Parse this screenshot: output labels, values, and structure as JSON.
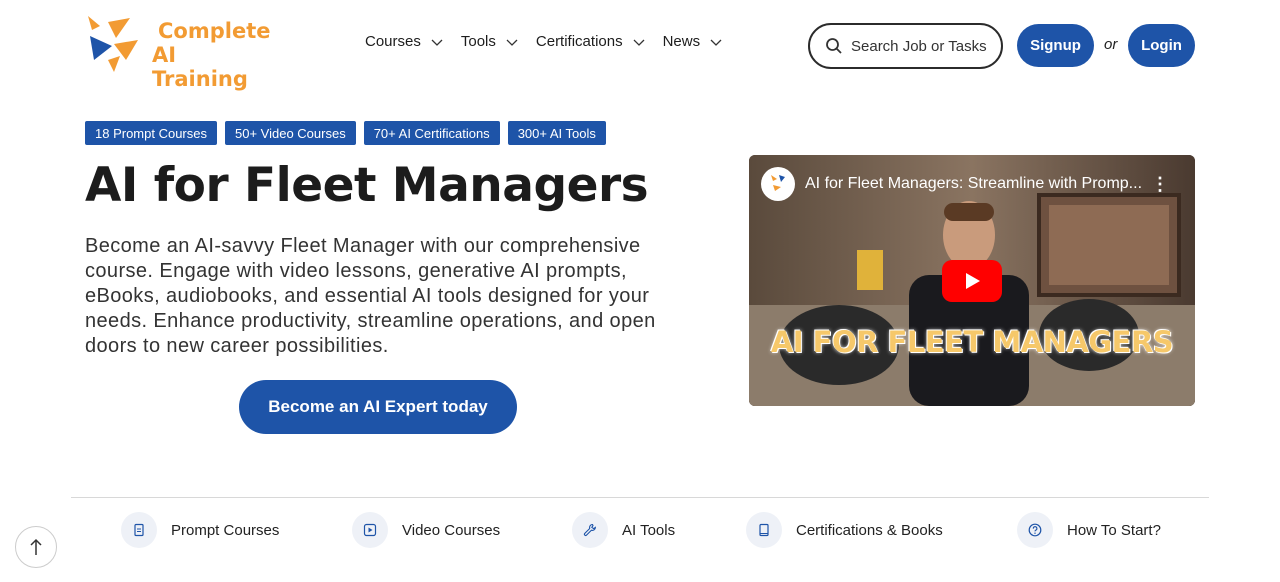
{
  "brand": {
    "line1": "Complete",
    "line2": "AI Training",
    "color": "#f29b33"
  },
  "nav": [
    {
      "label": "Courses"
    },
    {
      "label": "Tools"
    },
    {
      "label": "Certifications"
    },
    {
      "label": "News"
    }
  ],
  "search": {
    "placeholder": "Search Job or Tasks"
  },
  "auth": {
    "signup": "Signup",
    "or": "or",
    "login": "Login"
  },
  "badges": [
    "18 Prompt Courses",
    "50+ Video Courses",
    "70+ AI Certifications",
    "300+ AI Tools"
  ],
  "hero": {
    "title": "AI for Fleet Managers",
    "description": "Become an AI-savvy Fleet Manager with our comprehensive course. Engage with video lessons, generative AI prompts, eBooks, audiobooks, and essential AI tools designed for your needs. Enhance productivity, streamline operations, and open doors to new career possibilities.",
    "cta": "Become an AI Expert today"
  },
  "video": {
    "title": "AI for Fleet Managers: Streamline with Promp...",
    "caption": "AI FOR FLEET MANAGERS"
  },
  "bottom_nav": [
    {
      "label": "Prompt Courses",
      "icon": "document-icon"
    },
    {
      "label": "Video Courses",
      "icon": "play-icon"
    },
    {
      "label": "AI Tools",
      "icon": "wrench-icon"
    },
    {
      "label": "Certifications & Books",
      "icon": "book-icon"
    },
    {
      "label": "How To Start?",
      "icon": "help-icon"
    }
  ],
  "colors": {
    "primary": "#1e54a8",
    "accent": "#f29b33"
  }
}
